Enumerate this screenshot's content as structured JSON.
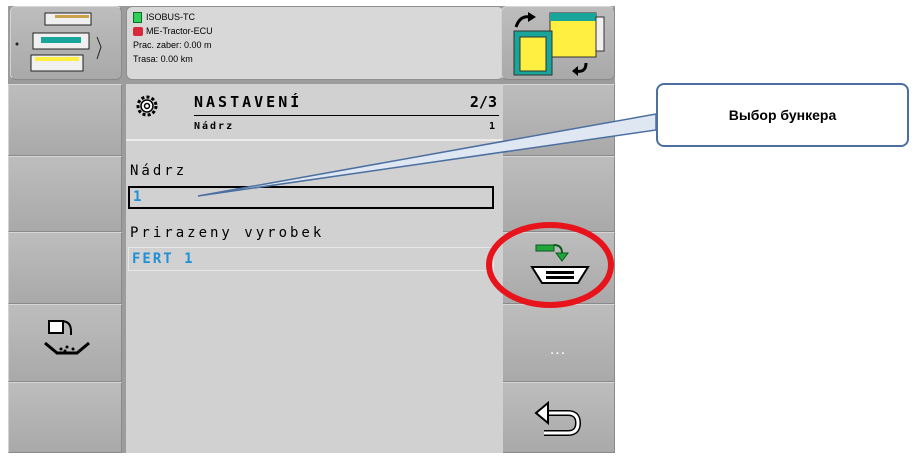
{
  "header": {
    "line1": "ISOBUS-TC",
    "line2": "ME-Tractor-ECU",
    "line3": "Prac. zaber: 0.00  m",
    "line4": "Trasa: 0.00  km"
  },
  "mask": {
    "title": "NASTAVENÍ",
    "page": "2/3",
    "subtitle": "Nádrz",
    "subtitle_value": "1",
    "field1_label": "Nádrz",
    "field1_value": "1",
    "field2_label": "Prirazeny vyrobek",
    "field2_value": "FERT 1"
  },
  "softkeys": {
    "more_label": "..."
  },
  "callout": {
    "text": "Выбор бункера"
  },
  "colors": {
    "value_blue": "#1e90d8",
    "highlight_red": "#e8141c",
    "callout_border": "#4c6fa0"
  }
}
